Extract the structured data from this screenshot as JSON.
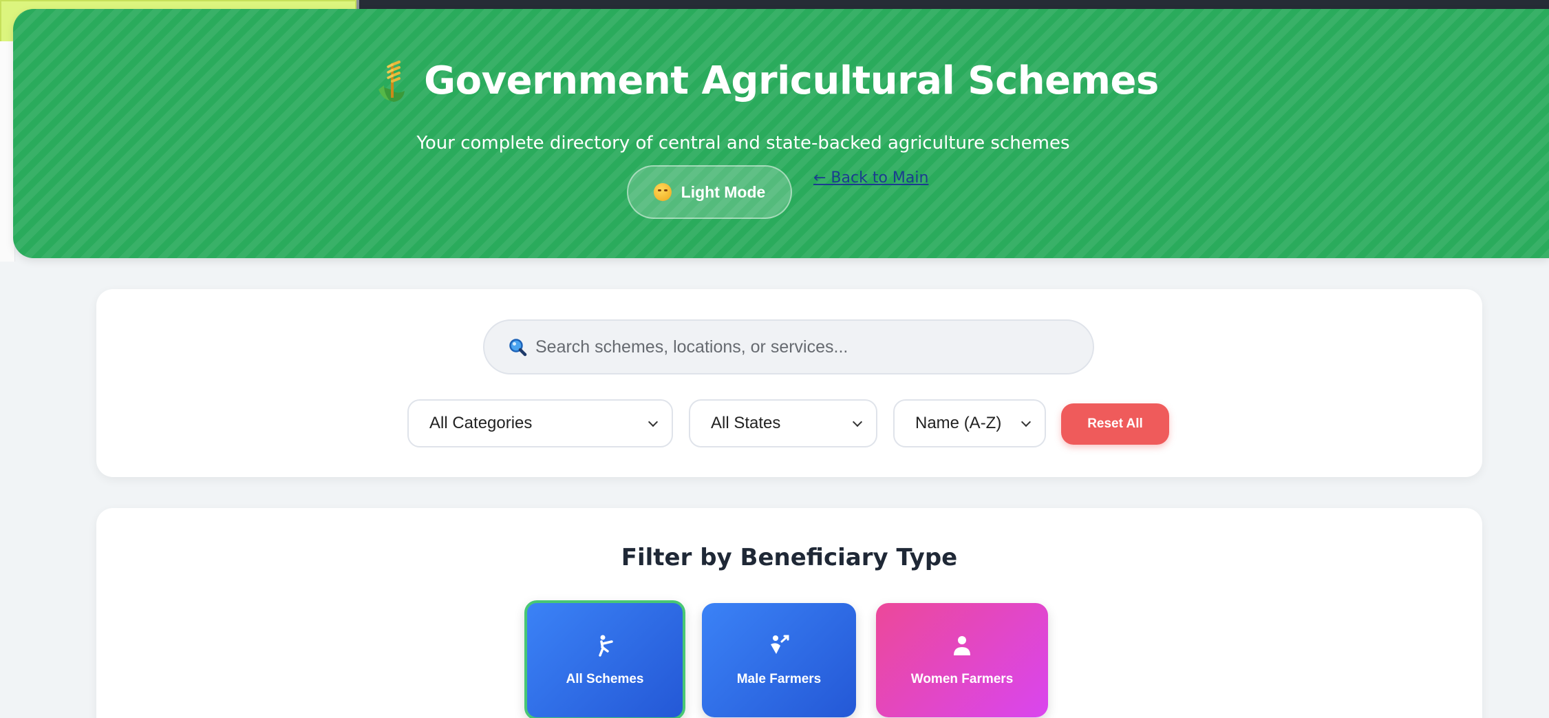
{
  "header": {
    "title": "Government Agricultural Schemes",
    "subtitle": "Your complete directory of central and state-backed agriculture schemes",
    "mode_button": "Light Mode",
    "back_link": "← Back to Main",
    "title_icon": "wheat-icon",
    "mode_icon": "smiley-icon"
  },
  "search": {
    "placeholder": "Search schemes, locations, or services...",
    "icon": "search-icon"
  },
  "filters": {
    "category": "All Categories",
    "state": "All States",
    "sort": "Name (A-Z)",
    "reset": "Reset All"
  },
  "beneficiary": {
    "title": "Filter by Beneficiary Type",
    "buttons": [
      {
        "label": "All Schemes",
        "icon": "farmer-icon",
        "selected": true
      },
      {
        "label": "Male Farmers",
        "icon": "male-farmer-icon",
        "selected": false
      },
      {
        "label": "Women Farmers",
        "icon": "person-icon",
        "selected": false
      }
    ]
  },
  "colors": {
    "hero_green": "#2aab5c",
    "reset_red": "#ef5b5b",
    "blue": "#2458d6",
    "pink": "#ec4899",
    "selected_border": "#48c774"
  }
}
